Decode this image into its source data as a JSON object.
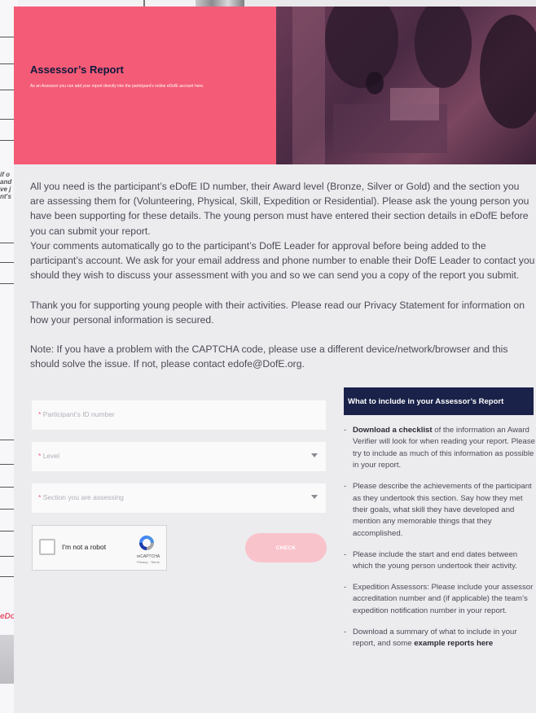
{
  "hero": {
    "title": "Assessor’s Report",
    "subtitle": "As an Assessor you can add your report directly into the participant’s online eDofE account here."
  },
  "intro": [
    "All you need is the participant’s eDofE ID number, their Award level (Bronze, Silver or Gold) and the section you are assessing them for (Volunteering, Physical, Skill, Expedition or Residential). Please ask the young person you have been supporting for these details. The young person must have entered their section details in eDofE before you can submit your report.",
    "Your comments automatically go to the participant’s DofE Leader for approval before being added to the participant’s account. We ask for your email address and phone number to enable their DofE Leader to contact you should they wish to discuss your assessment with you and so we can send you a copy of the report you submit.",
    "Thank you for supporting young people with their activities. Please read our Privacy Statement for information on how your personal information is secured.",
    "Note: If you have a problem with the CAPTCHA code, please use a different device/network/browser and this should solve the issue. If not, please contact edofe@DofE.org."
  ],
  "form": {
    "required_mark": "*",
    "participant_id_placeholder": "Participant’s ID number",
    "level_placeholder": "Level",
    "section_placeholder": "Section you are assessing",
    "captcha_label": "I'm not a robot",
    "captcha_brand": "reCAPTCHA",
    "captcha_links": "Privacy - Terms",
    "check_button": "CHECK"
  },
  "sidebar": {
    "title": "What to include in your Assessor’s Report",
    "tips": [
      {
        "bold": "Download a checklist",
        "text": " of the information an Award Verifier will look for when reading your report. Please try to include as much of this information as possible in your report."
      },
      {
        "bold": "",
        "text": "Please describe the achievements of the participant as they undertook this section. Say how they met their goals, what skill they have developed and mention any memorable things that they accomplished."
      },
      {
        "bold": "",
        "text": "Please include the start and end dates between which the young person undertook their activity."
      },
      {
        "bold": "",
        "text": "Expedition Assessors: Please include your assessor accreditation number and (if applicable) the team’s expedition notification number in your report."
      },
      {
        "prefix": "Download a summary of what to include in your report, and some ",
        "bold": "example reports here",
        "text": ""
      }
    ]
  },
  "background": {
    "fragment_text": "if o and ve j nt's",
    "pink_fragment": "eDo"
  },
  "colors": {
    "hero_pink": "#f45b76",
    "navy": "#1a2249",
    "check_button": "#f9c3cc"
  }
}
